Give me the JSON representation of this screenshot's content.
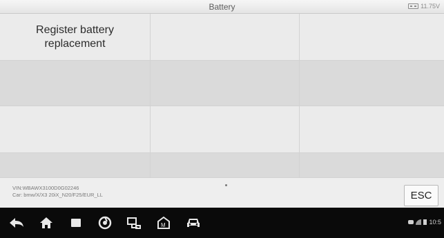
{
  "header": {
    "title": "Battery",
    "voltage": "11.75V"
  },
  "grid": {
    "rows": [
      [
        "Register battery replacement",
        "",
        ""
      ],
      [
        "",
        "",
        ""
      ],
      [
        "",
        "",
        ""
      ],
      [
        "",
        "",
        ""
      ]
    ]
  },
  "footer": {
    "vin": "VIN:WBAWX3100D0G02246",
    "car": "Car: bmw/X/X3 20iX_N20/F25/EUR_LL",
    "esc_label": "ESC"
  },
  "navbar": {
    "icons": [
      "back-icon",
      "home-icon",
      "recent-apps-icon",
      "browser-icon",
      "vci-icon",
      "maxisys-home-icon",
      "car-icon"
    ],
    "time": "10:5"
  }
}
